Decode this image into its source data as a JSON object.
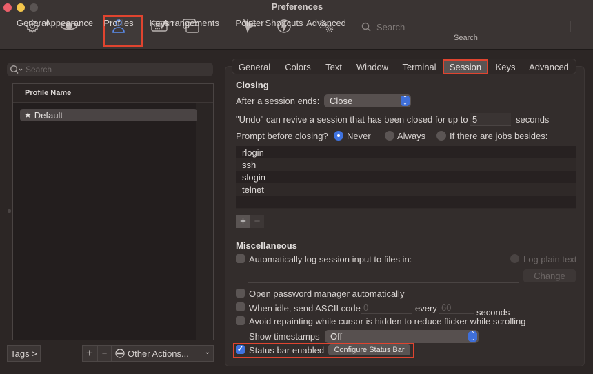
{
  "window": {
    "title": "Preferences"
  },
  "toolbar": {
    "items": [
      {
        "id": "general",
        "label": "General",
        "icon": "gear-icon"
      },
      {
        "id": "appearance",
        "label": "Appearance",
        "icon": "eye-icon"
      },
      {
        "id": "profiles",
        "label": "Profiles",
        "icon": "person-icon",
        "selected": true
      },
      {
        "id": "keys",
        "label": "Keys",
        "icon": "keyboard-icon"
      },
      {
        "id": "arrangements",
        "label": "Arrangements",
        "icon": "windows-icon"
      },
      {
        "id": "pointer",
        "label": "Pointer",
        "icon": "pointer-icon"
      },
      {
        "id": "shortcuts",
        "label": "Shortcuts",
        "icon": "bolt-icon"
      },
      {
        "id": "advanced",
        "label": "Advanced",
        "icon": "gears-icon"
      }
    ],
    "search": {
      "placeholder": "Search",
      "label": "Search"
    }
  },
  "profiles_pane": {
    "search_placeholder": "Search",
    "column_header": "Profile Name",
    "profiles": [
      {
        "name": "Default",
        "is_default": true,
        "selected": true
      }
    ],
    "tags_button": "Tags >",
    "add_button": "+",
    "remove_button": "−",
    "other_actions": "Other Actions..."
  },
  "tabs": [
    {
      "label": "General"
    },
    {
      "label": "Colors"
    },
    {
      "label": "Text"
    },
    {
      "label": "Window"
    },
    {
      "label": "Terminal"
    },
    {
      "label": "Session",
      "selected": true
    },
    {
      "label": "Keys"
    },
    {
      "label": "Advanced"
    }
  ],
  "session": {
    "closing": {
      "title": "Closing",
      "after_session_ends_label": "After a session ends:",
      "after_session_ends_value": "Close",
      "undo_label": "\"Undo\" can revive a session that has been closed for up to",
      "undo_value": "5",
      "undo_unit": "seconds",
      "prompt_label": "Prompt before closing?",
      "prompt_options": [
        {
          "label": "Never",
          "selected": true
        },
        {
          "label": "Always",
          "selected": false
        },
        {
          "label": "If there are jobs besides:",
          "selected": false
        }
      ],
      "jobs": [
        "rlogin",
        "ssh",
        "slogin",
        "telnet"
      ],
      "add_job": "+",
      "remove_job": "−"
    },
    "misc": {
      "title": "Miscellaneous",
      "auto_log_label": "Automatically log session input to files in:",
      "auto_log_checked": false,
      "log_plain_text_label": "Log plain text",
      "log_path": "",
      "change_button": "Change",
      "open_password_manager_label": "Open password manager automatically",
      "open_password_manager_checked": false,
      "idle_label": "When idle, send ASCII code",
      "idle_checked": false,
      "idle_code": "0",
      "idle_every_label": "every",
      "idle_interval": "60",
      "idle_unit": "seconds",
      "avoid_repaint_label": "Avoid repainting while cursor is hidden to reduce flicker while scrolling",
      "avoid_repaint_checked": false,
      "show_timestamps_label": "Show timestamps",
      "show_timestamps_value": "Off",
      "status_bar_label": "Status bar enabled",
      "status_bar_checked": true,
      "configure_status_bar": "Configure Status Bar"
    }
  },
  "colors": {
    "accent": "#3f73e0",
    "highlight": "#e0442f",
    "active_toolbar": "#5b8ef0"
  }
}
